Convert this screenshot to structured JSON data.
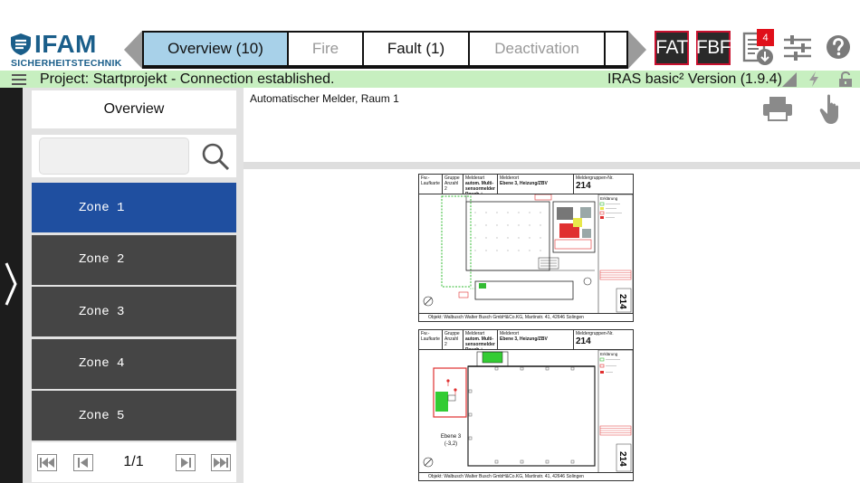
{
  "app": {
    "logo_main": "IFAM",
    "logo_sub": "SICHERHEITSTECHNIK"
  },
  "tabs": [
    {
      "label": "Overview (10)",
      "state": "active"
    },
    {
      "label": "Fire",
      "state": "dim"
    },
    {
      "label": "Fault (1)",
      "state": "normal"
    },
    {
      "label": "Deactivation",
      "state": "dim"
    }
  ],
  "toolbar": {
    "fat_label": "FAT",
    "fbf_label": "FBF",
    "doc_badge": "4",
    "accent_color": "#c8102e"
  },
  "status": {
    "project": "Project:  Startprojekt  -  Connection established.",
    "version": "IRAS basic² Version (1.9.4)",
    "bar_color": "#c7efc0"
  },
  "sidebar": {
    "title": "Overview",
    "search": {
      "value": "",
      "placeholder": ""
    },
    "zones": [
      {
        "label": "Zone 1",
        "selected": true
      },
      {
        "label": "Zone 2",
        "selected": false
      },
      {
        "label": "Zone 3",
        "selected": false
      },
      {
        "label": "Zone 4",
        "selected": false
      },
      {
        "label": "Zone 5",
        "selected": false
      }
    ],
    "pager": {
      "text": "1/1"
    }
  },
  "main": {
    "title": "Automatischer Melder, Raum 1"
  },
  "drawings": [
    {
      "col1": "Fw.-Laufkarte",
      "col2": "Gruppe",
      "col2_value": "Anzahl",
      "col2_num": "2",
      "col3": "Melderart",
      "col3_value": "autom. Multi-sensormelder Rauch + Wärme",
      "col4": "Melderort",
      "col4_value": "Ebene 3, Heizung/ZBV",
      "col5": "Meldergruppen-Nr.",
      "number": "214",
      "side_number": "214",
      "legend_title": "Erklärung",
      "footer": "Objekt:  Walbusch Walter Busch GmbH&Co.KG, Martinstr. 41, 42646 Solingen"
    },
    {
      "col1": "Fw.-Laufkarte",
      "col2": "Gruppe",
      "col2_value": "Anzahl",
      "col2_num": "2",
      "col3": "Melderart",
      "col3_value": "autom. Multi-sensormelder Rauch + Wärme",
      "col4": "Melderort",
      "col4_value": "Ebene 3, Heizung/ZBV",
      "col5": "Meldergruppen-Nr.",
      "number": "214",
      "side_number": "214",
      "legend_title": "Erklärung",
      "level_label": "Ebene 3",
      "level_sub": "(-3,2)",
      "footer": "Objekt:  Walbusch Walter Busch GmbH&Co.KG, Martinstr. 41, 42646 Solingen"
    }
  ]
}
